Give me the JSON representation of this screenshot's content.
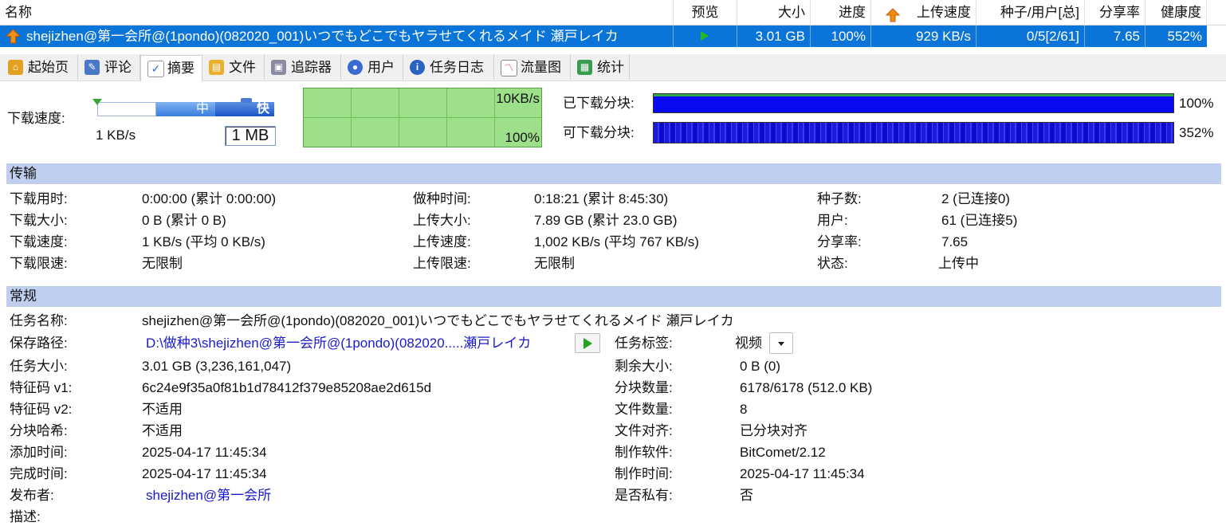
{
  "columns": {
    "name": "名称",
    "preview": "预览",
    "size": "大小",
    "progress": "进度",
    "upload_speed": "上传速度",
    "seeds_peers": "种子/用户[总]",
    "ratio": "分享率",
    "health": "健康度"
  },
  "task_row": {
    "name": "shejizhen@第一会所@(1pondo)(082020_001)いつでもどこでもヤラせてくれるメイド 瀬戸レイカ",
    "size": "3.01 GB",
    "progress": "100%",
    "upload_speed": "929 KB/s",
    "seeds_peers": "0/5[2/61]",
    "ratio": "7.65",
    "health": "552%"
  },
  "tabs": [
    {
      "label": "起始页",
      "icon": "home-icon",
      "color": "#e0a020"
    },
    {
      "label": "评论",
      "icon": "comment-icon",
      "color": "#4a78c8"
    },
    {
      "label": "摘要",
      "icon": "summary-check-icon",
      "color": "#3a7a3a"
    },
    {
      "label": "文件",
      "icon": "file-icon",
      "color": "#e8b030"
    },
    {
      "label": "追踪器",
      "icon": "tracker-icon",
      "color": "#8a8aa0"
    },
    {
      "label": "用户",
      "icon": "users-icon",
      "color": "#3a6ad0"
    },
    {
      "label": "任务日志",
      "icon": "info-icon",
      "color": "#2a62c0"
    },
    {
      "label": "流量图",
      "icon": "chart-icon",
      "color": "#c03030"
    },
    {
      "label": "统计",
      "icon": "stats-icon",
      "color": "#3a9a50"
    }
  ],
  "speed": {
    "label": "下载速度:",
    "slider_mid": "中",
    "slider_fast": "快",
    "current": "1 KB/s",
    "limit_value": "1 MB",
    "graph_max": "10KB/s",
    "graph_pct": "100%"
  },
  "pieces": {
    "downloaded_label": "已下载分块:",
    "downloaded_pct": "100%",
    "available_label": "可下载分块:",
    "available_pct": "352%"
  },
  "transfer": {
    "title": "传输",
    "rows": [
      {
        "l1": "下载用时:",
        "v1": "0:00:00 (累计 0:00:00)",
        "l2": "做种时间:",
        "v2": "0:18:21 (累计 8:45:30)",
        "l3": "种子数:",
        "v3": "2 (已连接0)"
      },
      {
        "l1": "下载大小:",
        "v1": "0 B (累计 0 B)",
        "l2": "上传大小:",
        "v2": "7.89 GB (累计 23.0 GB)",
        "l3": "用户:",
        "v3": "61 (已连接5)"
      },
      {
        "l1": "下载速度:",
        "v1": "1 KB/s (平均 0 KB/s)",
        "l2": "上传速度:",
        "v2": "1,002 KB/s (平均 767 KB/s)",
        "l3": "分享率:",
        "v3": "7.65"
      },
      {
        "l1": "下载限速:",
        "v1": "无限制",
        "l2": "上传限速:",
        "v2": "无限制",
        "l3": "状态:",
        "v3": "上传中"
      }
    ]
  },
  "general": {
    "title": "常规",
    "task_name_label": "任务名称:",
    "task_name": "shejizhen@第一会所@(1pondo)(082020_001)いつでもどこでもヤラせてくれるメイド 瀬戸レイカ",
    "save_path_label": "保存路径:",
    "save_path": "D:\\做种3\\shejizhen@第一会所@(1pondo)(082020.....瀬戸レイカ",
    "tag_label": "任务标签:",
    "tag_value": "视频",
    "left_rows": [
      {
        "label": "任务大小:",
        "value": "3.01 GB (3,236,161,047)"
      },
      {
        "label": "特征码 v1:",
        "value": "6c24e9f35a0f81b1d78412f379e85208ae2d615d"
      },
      {
        "label": "特征码 v2:",
        "value": "不适用"
      },
      {
        "label": "分块哈希:",
        "value": "不适用"
      },
      {
        "label": "添加时间:",
        "value": "2025-04-17 11:45:34"
      },
      {
        "label": "完成时间:",
        "value": "2025-04-17 11:45:34"
      }
    ],
    "right_rows": [
      {
        "label": "剩余大小:",
        "value": "0 B (0)"
      },
      {
        "label": "分块数量:",
        "value": "6178/6178 (512.0 KB)"
      },
      {
        "label": "文件数量:",
        "value": "8"
      },
      {
        "label": "文件对齐:",
        "value": "已分块对齐"
      },
      {
        "label": "制作软件:",
        "value": "BitComet/2.12"
      },
      {
        "label": "制作时间:",
        "value": "2025-04-17 11:45:34"
      },
      {
        "label": "是否私有:",
        "value": "否"
      }
    ],
    "publisher_label": "发布者:",
    "publisher": "shejizhen@第一会所",
    "description_label": "描述:"
  }
}
